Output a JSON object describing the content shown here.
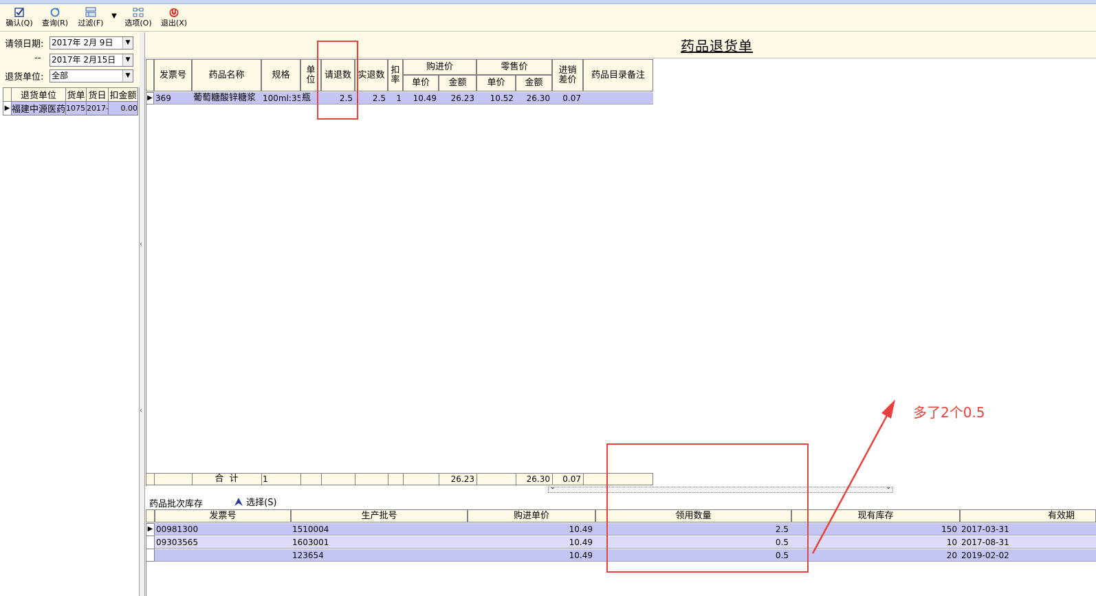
{
  "toolbar": {
    "confirm": "确认(Q)",
    "query": "查询(R)",
    "filter": "过滤(F)",
    "options": "选项(O)",
    "exit": "退出(X)"
  },
  "filters": {
    "date_label": "请领日期:",
    "date_from": "2017年  2月 9日",
    "dash": "--",
    "date_to": "2017年  2月15日",
    "unit_label": "退货单位:",
    "unit_value": "全部"
  },
  "left_grid": {
    "columns": [
      "退货单位",
      "货单",
      "货日",
      "扣金额"
    ],
    "rows": [
      [
        "福建中源医药",
        "1075",
        "2017-",
        "0.00"
      ]
    ]
  },
  "doc_title": "药品退货单",
  "main_grid": {
    "headers": {
      "invoice": "发票号",
      "name": "药品名称",
      "spec": "规格",
      "unit": "单位",
      "req_qty": "请退数",
      "act_qty": "实退数",
      "discount": "扣率",
      "purchase": "购进价",
      "retail": "零售价",
      "unit_price": "单价",
      "amount": "金额",
      "margin": "进销差价",
      "remark": "药品目录备注"
    },
    "row": {
      "invoice": "369",
      "name": "葡萄糖酸锌糖浆",
      "spec": "100ml:35",
      "unit": "瓶",
      "req_qty": "2.5",
      "act_qty": "2.5",
      "discount": "1",
      "p_price": "10.49",
      "p_amount": "26.23",
      "r_price": "10.52",
      "r_amount": "26.30",
      "margin": "0.07"
    },
    "total": {
      "label": "合  计",
      "count": "1",
      "p_amount": "26.23",
      "r_amount": "26.30",
      "margin": "0.07"
    }
  },
  "batch": {
    "label": "药品批次库存",
    "select": "选择(S)",
    "columns": [
      "发票号",
      "生产批号",
      "购进单价",
      "领用数量",
      "现有库存",
      "有效期"
    ],
    "rows": [
      [
        "00981300",
        "1510004",
        "10.49",
        "2.5",
        "150",
        "2017-03-31"
      ],
      [
        "09303565",
        "1603001",
        "10.49",
        "0.5",
        "10",
        "2017-08-31"
      ],
      [
        "",
        "123654",
        "10.49",
        "0.5",
        "20",
        "2019-02-02"
      ]
    ]
  },
  "annotation": {
    "text": "多了2个0.5",
    "color": "#e8403a"
  },
  "colors": {
    "toolbar_bg": "#fffbe6",
    "selected_row": "#c5c5f5",
    "alt_row": "#dcdcf8"
  }
}
